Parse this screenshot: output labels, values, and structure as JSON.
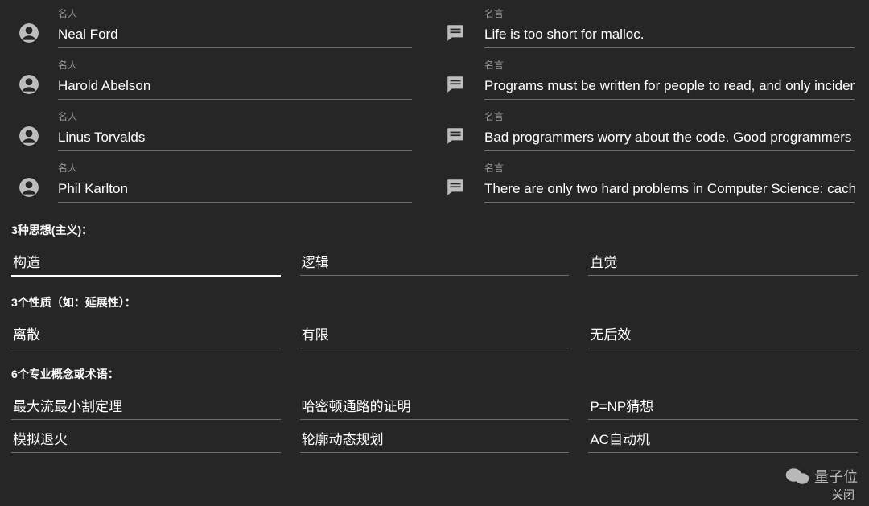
{
  "labels": {
    "person": "名人",
    "quote": "名言"
  },
  "quotes": [
    {
      "person": "Neal Ford",
      "quote": "Life is too short for malloc."
    },
    {
      "person": "Harold Abelson",
      "quote": "Programs must be written for people to read, and only incidentally for machines to execute."
    },
    {
      "person": "Linus Torvalds",
      "quote": "Bad programmers worry about the code. Good programmers worry about data structures and their relationships."
    },
    {
      "person": "Phil Karlton",
      "quote": "There are only two hard problems in Computer Science: cache invalidation and naming things."
    }
  ],
  "sections": {
    "ideas": {
      "title": "3种思想(主义)：",
      "items": [
        "构造",
        "逻辑",
        "直觉"
      ]
    },
    "properties": {
      "title": "3个性质（如：延展性）：",
      "items": [
        "离散",
        "有限",
        "无后效"
      ]
    },
    "concepts": {
      "title": "6个专业概念或术语：",
      "items": [
        "最大流最小割定理",
        "哈密顿通路的证明",
        "P=NP猜想",
        "模拟退火",
        "轮廓动态规划",
        "AC自动机"
      ]
    }
  },
  "close_label": "关闭",
  "watermark_text": "量子位"
}
